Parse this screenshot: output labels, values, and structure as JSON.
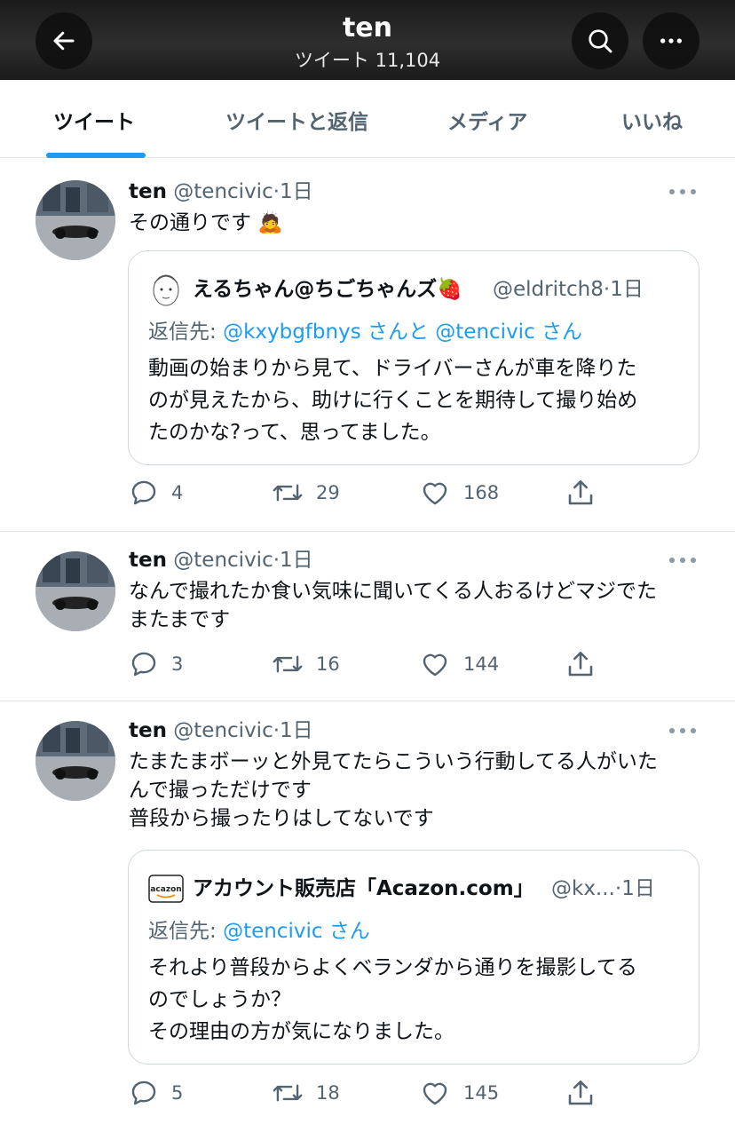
{
  "header": {
    "title": "ten",
    "subtitle": "ツイート 11,104",
    "back_icon": "arrow-left-icon",
    "search_icon": "search-icon",
    "more_icon": "more-horizontal-icon"
  },
  "tabs": [
    {
      "label": "ツイート",
      "active": true
    },
    {
      "label": "ツイートと返信",
      "active": false
    },
    {
      "label": "メディア",
      "active": false
    },
    {
      "label": "いいね",
      "active": false
    }
  ],
  "colors": {
    "accent": "#1d9bf0",
    "muted": "#536471",
    "text": "#0f1419"
  },
  "tweets": [
    {
      "name": "ten",
      "handle": "@tencivic",
      "dot": "·",
      "time": "1日",
      "lines": [
        "その通りです 🙇"
      ],
      "quote": {
        "name": "えるちゃん@ちごちゃんズ🍓",
        "handle": "@eldritch8",
        "dot": "·",
        "time": "1日",
        "reply_prefix": "返信先: ",
        "reply_links": "@kxybgfbnys さんと @tencivic さん",
        "lines": [
          "動画の始まりから見て、ドライバーさんが車を降りた",
          "のが見えたから、助けに行くことを期待して撮り始め",
          "たのかな?って、思ってました。"
        ]
      },
      "counts": {
        "replies": "4",
        "retweets": "29",
        "likes": "168"
      }
    },
    {
      "name": "ten",
      "handle": "@tencivic",
      "dot": "·",
      "time": "1日",
      "lines": [
        "なんで撮れたか食い気味に聞いてくる人おるけどマジでた",
        "またまです"
      ],
      "counts": {
        "replies": "3",
        "retweets": "16",
        "likes": "144"
      }
    },
    {
      "name": "ten",
      "handle": "@tencivic",
      "dot": "·",
      "time": "1日",
      "lines": [
        "たまたまボーッと外見てたらこういう行動してる人がいた",
        "んで撮っただけです",
        "普段から撮ったりはしてないです"
      ],
      "quote": {
        "avatar_text": "acazon",
        "name": "アカウント販売店「Acazon.com」",
        "handle": "@kx...",
        "dot": "·",
        "time": "1日",
        "reply_prefix": "返信先: ",
        "reply_links": "@tencivic さん",
        "lines": [
          "それより普段からよくベランダから通りを撮影してる",
          "のでしょうか？",
          "その理由の方が気になりました。"
        ]
      },
      "counts": {
        "replies": "5",
        "retweets": "18",
        "likes": "145"
      }
    }
  ]
}
